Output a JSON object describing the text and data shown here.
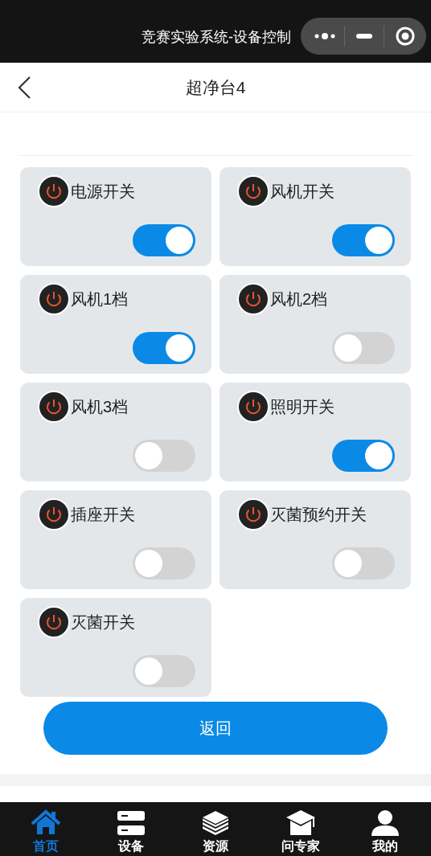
{
  "title_bar": {
    "title": "竞赛实验系统-设备控制"
  },
  "header": {
    "title": "超净台4"
  },
  "switches": [
    {
      "label": "电源开关",
      "on": true
    },
    {
      "label": "风机开关",
      "on": true
    },
    {
      "label": "风机1档",
      "on": true
    },
    {
      "label": "风机2档",
      "on": false
    },
    {
      "label": "风机3档",
      "on": false
    },
    {
      "label": "照明开关",
      "on": true
    },
    {
      "label": "插座开关",
      "on": false
    },
    {
      "label": "灭菌预约开关",
      "on": false
    },
    {
      "label": "灭菌开关",
      "on": false
    }
  ],
  "back_button": "返回",
  "nav": [
    {
      "label": "首页",
      "kind": "home",
      "selected": true
    },
    {
      "label": "设备",
      "kind": "server",
      "selected": false
    },
    {
      "label": "资源",
      "kind": "layers",
      "selected": false
    },
    {
      "label": "问专家",
      "kind": "cap",
      "selected": false
    },
    {
      "label": "我的",
      "kind": "user",
      "selected": false
    }
  ]
}
